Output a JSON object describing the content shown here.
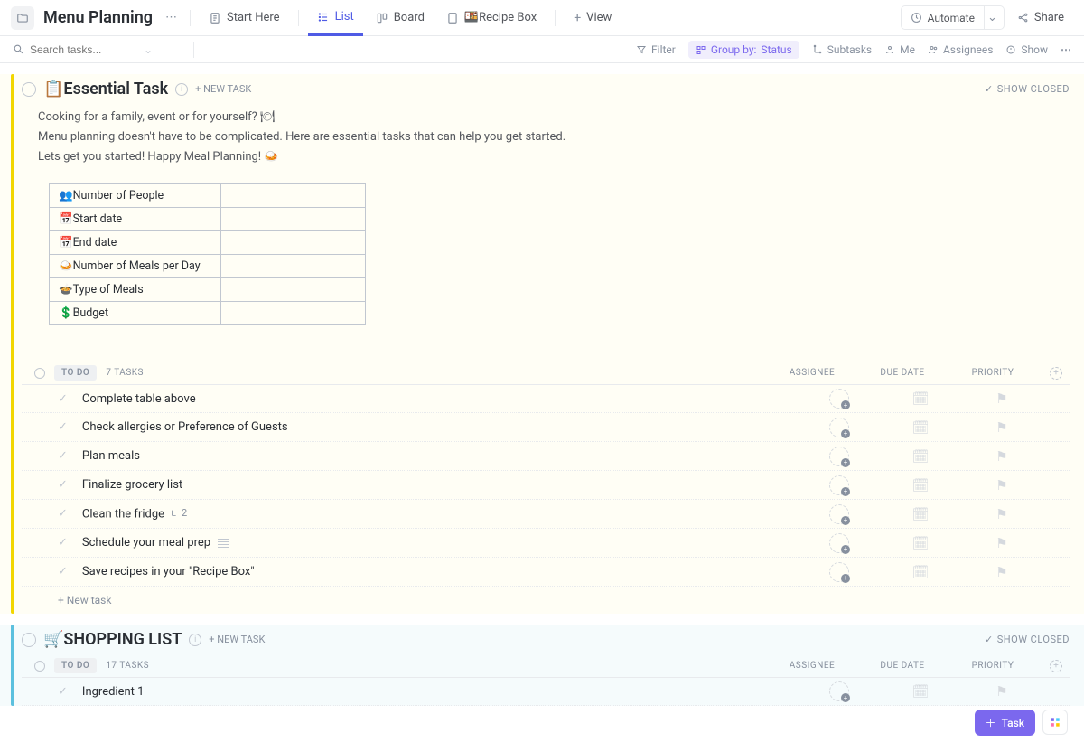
{
  "header": {
    "title": "Menu Planning",
    "tabs": [
      {
        "label": "Start Here",
        "icon": "doc"
      },
      {
        "label": "List",
        "icon": "list",
        "active": true
      },
      {
        "label": "Board",
        "icon": "board"
      },
      {
        "label": "🍱Recipe Box",
        "icon": "doc"
      }
    ],
    "add_view": "View",
    "automate": "Automate",
    "share": "Share"
  },
  "filterbar": {
    "search_placeholder": "Search tasks...",
    "filter": "Filter",
    "group_by_label": "Group by:",
    "group_by_value": "Status",
    "subtasks": "Subtasks",
    "me": "Me",
    "assignees": "Assignees",
    "show": "Show"
  },
  "sections": [
    {
      "color": "#f2d600",
      "bg": "bg-yellow",
      "title": "📋Essential Task",
      "new_task": "+ NEW TASK",
      "show_closed": "SHOW CLOSED",
      "description_lines": [
        "Cooking for a family, event or for yourself? 🍽",
        "Menu planning doesn't have to be complicated. Here are essential tasks that can help you get started.",
        "Lets get you started! Happy Meal Planning! 🍛"
      ],
      "info_rows": [
        "👥Number of People",
        "📅Start date",
        "📅End date",
        "🍛Number of Meals per Day",
        "🍲Type of Meals",
        "💲Budget"
      ],
      "status_label": "TO DO",
      "task_count": "7 TASKS",
      "columns": {
        "assignee": "ASSIGNEE",
        "due": "DUE DATE",
        "priority": "PRIORITY"
      },
      "tasks": [
        {
          "name": "Complete table above"
        },
        {
          "name": "Check allergies or Preference of Guests"
        },
        {
          "name": "Plan meals"
        },
        {
          "name": "Finalize grocery list"
        },
        {
          "name": "Clean the fridge",
          "subtasks": "2"
        },
        {
          "name": "Schedule your meal prep",
          "note": true
        },
        {
          "name": "Save recipes in your \"Recipe Box\""
        }
      ],
      "new_task_bottom": "+ New task"
    },
    {
      "color": "#5bc0de",
      "bg": "bg-blue",
      "title": "🛒SHOPPING LIST",
      "new_task": "+ NEW TASK",
      "show_closed": "SHOW CLOSED",
      "status_label": "TO DO",
      "task_count": "17 TASKS",
      "columns": {
        "assignee": "ASSIGNEE",
        "due": "DUE DATE",
        "priority": "PRIORITY"
      },
      "tasks": [
        {
          "name": "Ingredient 1"
        }
      ]
    }
  ],
  "float": {
    "task": "Task"
  }
}
